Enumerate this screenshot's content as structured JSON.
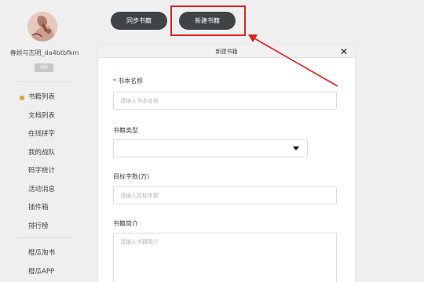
{
  "sidebar": {
    "username": "春娇与志明_da4btbfkm",
    "vip_badge": "VIP",
    "nav_items": [
      {
        "label": "书籍列表",
        "active": true
      },
      {
        "label": "文档列表",
        "active": false
      },
      {
        "label": "在线拼字",
        "active": false
      },
      {
        "label": "我的战队",
        "active": false
      },
      {
        "label": "码字统计",
        "active": false
      },
      {
        "label": "活动消息",
        "active": false
      },
      {
        "label": "插件箱",
        "active": false
      },
      {
        "label": "排行榜",
        "active": false
      }
    ],
    "bottom_items": [
      {
        "label": "橙瓜淘书"
      },
      {
        "label": "橙瓜APP"
      }
    ],
    "active_color": "#e8a02f"
  },
  "toolbar": {
    "sync_label": "同步书籍",
    "new_book_label": "新建书籍"
  },
  "dialog": {
    "title": "新建书籍",
    "close_icon": "close-icon",
    "fields": {
      "book_name": {
        "required_mark": "*",
        "label": "书本名称",
        "placeholder": "请输入书本名称",
        "value": ""
      },
      "book_type": {
        "label": "书籍类型",
        "value": ""
      },
      "target_words": {
        "label": "目标字数(万)",
        "placeholder": "请输入目标字数",
        "value": ""
      },
      "intro": {
        "label": "书籍简介",
        "placeholder": "请输入书籍简介",
        "value": ""
      }
    }
  },
  "annotation": {
    "color": "#e02020"
  }
}
